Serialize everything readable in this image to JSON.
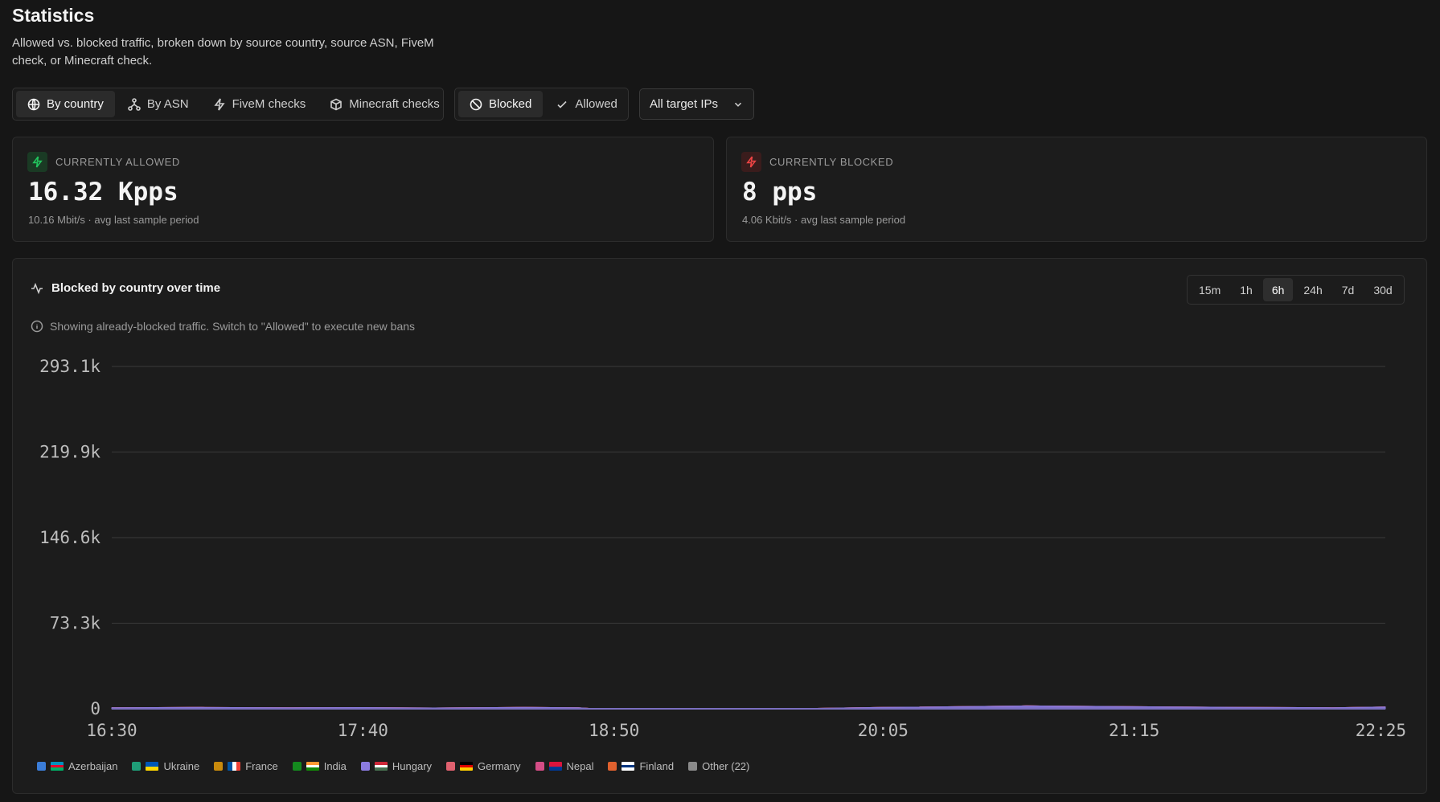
{
  "page": {
    "title": "Statistics",
    "subtitle": "Allowed vs. blocked traffic, broken down by source country, source ASN, FiveM check, or Minecraft check."
  },
  "view_tabs": [
    {
      "label": "By country",
      "icon": "globe-icon",
      "active": true
    },
    {
      "label": "By ASN",
      "icon": "network-icon",
      "active": false
    },
    {
      "label": "FiveM checks",
      "icon": "bolt-icon",
      "active": false
    },
    {
      "label": "Minecraft checks",
      "icon": "cube-icon",
      "active": false
    }
  ],
  "mode_tabs": [
    {
      "label": "Blocked",
      "icon": "ban-icon",
      "active": true
    },
    {
      "label": "Allowed",
      "icon": "check-icon",
      "active": false
    }
  ],
  "target_select": {
    "value": "All target IPs",
    "icon": "chevron-down-icon"
  },
  "cards": {
    "allowed": {
      "label": "Currently allowed",
      "value": "16.32 Kpps",
      "sub": "10.16 Mbit/s · avg last sample period",
      "accent": "#22c55e",
      "icon": "bolt-icon"
    },
    "blocked": {
      "label": "Currently blocked",
      "value": "8 pps",
      "sub": "4.06 Kbit/s · avg last sample period",
      "accent": "#ef4444",
      "icon": "bolt-icon"
    }
  },
  "chart_panel": {
    "title": "Blocked by country over time",
    "info": "Showing already-blocked traffic. Switch to \"Allowed\" to execute new bans",
    "ranges": [
      {
        "label": "15m",
        "active": false
      },
      {
        "label": "1h",
        "active": false
      },
      {
        "label": "6h",
        "active": true
      },
      {
        "label": "24h",
        "active": false
      },
      {
        "label": "7d",
        "active": false
      },
      {
        "label": "30d",
        "active": false
      }
    ]
  },
  "chart_data": {
    "type": "area",
    "stacked": true,
    "x": [
      "16:30",
      "16:55",
      "17:20",
      "17:40",
      "18:00",
      "18:25",
      "18:40",
      "18:45",
      "18:50",
      "18:55",
      "19:00",
      "19:05",
      "19:10",
      "19:15",
      "19:20",
      "19:25",
      "19:30",
      "19:35",
      "19:40",
      "20:05",
      "20:45",
      "21:15",
      "21:45",
      "22:10",
      "22:25"
    ],
    "x_ticks": [
      "16:30",
      "17:40",
      "18:50",
      "20:05",
      "21:15",
      "22:25"
    ],
    "y_ticks": [
      "0",
      "73.3k",
      "146.6k",
      "219.9k",
      "293.1k"
    ],
    "ylim": [
      0,
      293100
    ],
    "grid": true,
    "legend_position": "bottom-left",
    "series": [
      {
        "name": "Azerbaijan",
        "flag": "AZ",
        "color": "#3b7dd8",
        "values": [
          0,
          0,
          0,
          0,
          0,
          0,
          0,
          0,
          0,
          0,
          0,
          0,
          0,
          0,
          0,
          0,
          0,
          0,
          0,
          0,
          0,
          0,
          0,
          0,
          0
        ]
      },
      {
        "name": "Ukraine",
        "flag": "UA",
        "color": "#1f9e78",
        "values": [
          0,
          0,
          0,
          0,
          0,
          0,
          0,
          0,
          0,
          0,
          0,
          0,
          0,
          0,
          0,
          0,
          0,
          0,
          0,
          0,
          0,
          0,
          0,
          0,
          0
        ]
      },
      {
        "name": "France",
        "flag": "FR",
        "color": "#c88a0c",
        "values": [
          0,
          0,
          0,
          0,
          0,
          0,
          0,
          0,
          0,
          0,
          0,
          0,
          0,
          0,
          0,
          0,
          0,
          0,
          0,
          0,
          0,
          0,
          0,
          0,
          0
        ]
      },
      {
        "name": "India",
        "flag": "IN",
        "color": "#148a1e",
        "values": [
          0,
          0,
          0,
          0,
          0,
          0,
          0,
          0,
          0,
          0,
          0,
          0,
          0,
          0,
          0,
          0,
          0,
          0,
          0,
          0,
          0,
          0,
          0,
          0,
          0
        ]
      },
      {
        "name": "Hungary",
        "flag": "HU",
        "color": "#8b7be0",
        "values": [
          800,
          1200,
          900,
          1000,
          700,
          1200,
          800,
          0,
          0,
          0,
          0,
          0,
          0,
          0,
          0,
          0,
          0,
          0,
          0,
          1200,
          2500,
          1800,
          1200,
          900,
          1500
        ]
      },
      {
        "name": "Germany",
        "flag": "DE",
        "color": "#e0616f",
        "values": [
          0,
          0,
          0,
          0,
          0,
          0,
          0,
          0,
          0,
          0,
          0,
          0,
          0,
          0,
          0,
          0,
          0,
          0,
          0,
          0,
          0,
          0,
          0,
          0,
          0
        ]
      },
      {
        "name": "Nepal",
        "flag": "NP",
        "color": "#d44d86",
        "values": [
          0,
          0,
          0,
          0,
          0,
          0,
          0,
          0,
          0,
          0,
          0,
          0,
          0,
          0,
          0,
          0,
          0,
          0,
          0,
          0,
          0,
          0,
          0,
          0,
          0
        ]
      },
      {
        "name": "Finland",
        "flag": "FI",
        "color": "#e0612e",
        "values": [
          0,
          0,
          0,
          0,
          0,
          0,
          0,
          0,
          0,
          0,
          0,
          0,
          0,
          0,
          0,
          0,
          0,
          0,
          0,
          0,
          0,
          0,
          0,
          0,
          0
        ]
      },
      {
        "name": "Other (22)",
        "flag": "",
        "color": "#8a8a8a",
        "values": [
          0,
          0,
          0,
          0,
          0,
          0,
          0,
          0,
          0,
          0,
          0,
          0,
          0,
          0,
          0,
          0,
          0,
          0,
          0,
          0,
          0,
          0,
          0,
          0,
          0
        ]
      }
    ]
  }
}
